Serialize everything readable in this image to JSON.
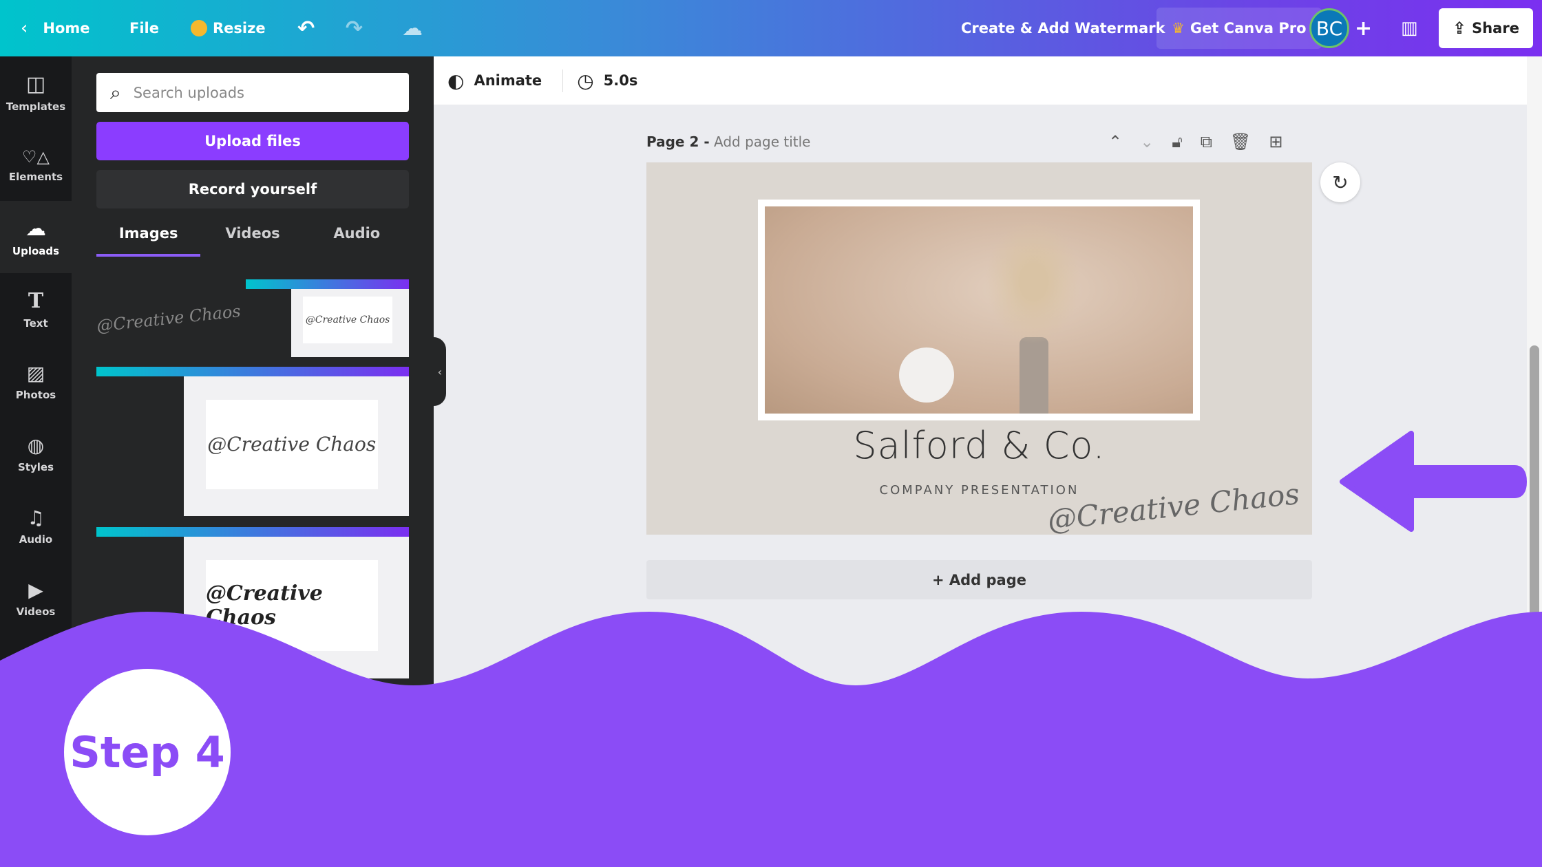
{
  "topbar": {
    "home": "Home",
    "file": "File",
    "resize": "Resize",
    "watermark": "Create & Add Watermark",
    "pro": "Get Canva Pro",
    "avatar": "BC",
    "share": "Share"
  },
  "rail": [
    {
      "label": "Templates",
      "icon": "templates-icon"
    },
    {
      "label": "Elements",
      "icon": "elements-icon"
    },
    {
      "label": "Uploads",
      "icon": "upload-cloud-icon"
    },
    {
      "label": "Text",
      "icon": "text-icon"
    },
    {
      "label": "Photos",
      "icon": "photos-icon"
    },
    {
      "label": "Styles",
      "icon": "palette-icon"
    },
    {
      "label": "Audio",
      "icon": "music-icon"
    },
    {
      "label": "Videos",
      "icon": "video-icon"
    }
  ],
  "panel": {
    "search_placeholder": "Search uploads",
    "upload": "Upload files",
    "record": "Record yourself",
    "tabs": [
      "Images",
      "Videos",
      "Audio"
    ],
    "thumb_text": "@Creative Chaos"
  },
  "toolbar": {
    "animate": "Animate",
    "duration": "5.0s"
  },
  "page": {
    "label": "Page 2 -",
    "title_placeholder": "Add page title",
    "heading": "Salford & Co.",
    "subheading": "COMPANY PRESENTATION",
    "watermark": "@Creative Chaos",
    "add_page": "+ Add page"
  },
  "overlay": {
    "step": "Step 4",
    "accent": "#8b4cf6"
  }
}
